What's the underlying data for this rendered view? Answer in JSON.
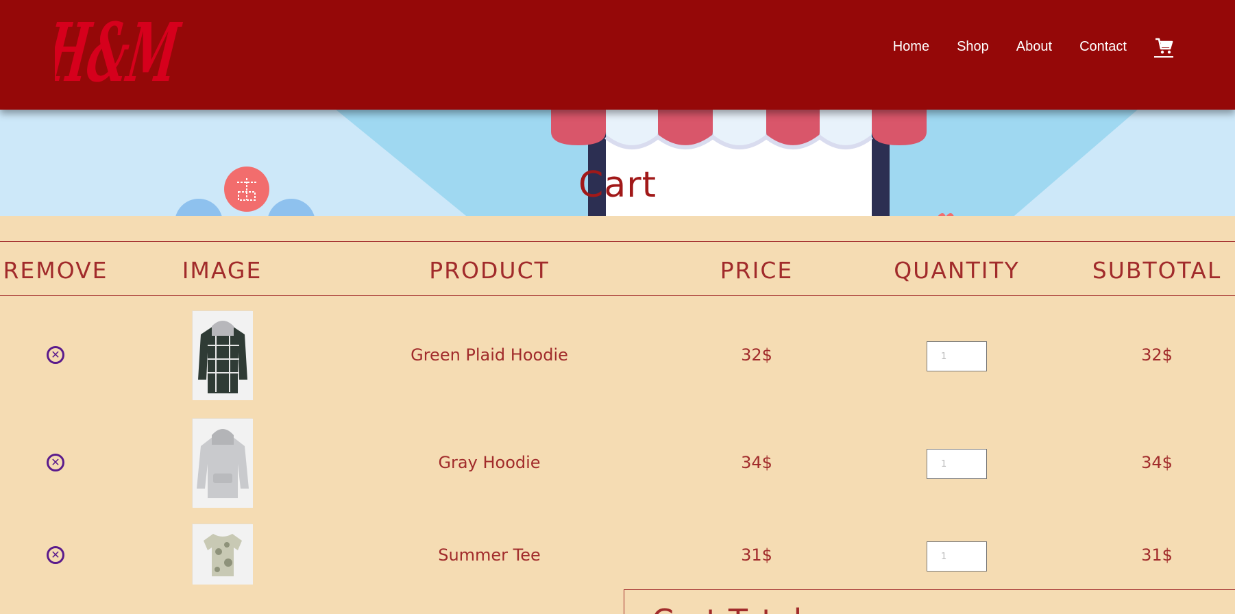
{
  "brand": {
    "logo_text": "H&M"
  },
  "nav": {
    "items": [
      "Home",
      "Shop",
      "About",
      "Contact"
    ],
    "cart_icon": "cart-icon"
  },
  "hero": {
    "title": "Cart"
  },
  "table": {
    "headers": [
      "REMOVE",
      "IMAGE",
      "PRODUCT",
      "PRICE",
      "QUANTITY",
      "SUBTOTAL"
    ],
    "rows": [
      {
        "product": "Green Plaid Hoodie",
        "price": "32$",
        "quantity": "1",
        "subtotal": "32$",
        "image": "green-plaid-hoodie-image"
      },
      {
        "product": "Gray Hoodie",
        "price": "34$",
        "quantity": "1",
        "subtotal": "34$",
        "image": "gray-hoodie-image"
      },
      {
        "product": "Summer Tee",
        "price": "31$",
        "quantity": "1",
        "subtotal": "31$",
        "image": "summer-tee-image"
      }
    ]
  },
  "totals": {
    "title": "Cart Totals"
  },
  "colors": {
    "header_bg": "#950808",
    "page_bg": "#f5dcb3",
    "accent_text": "#a12b2b",
    "remove_icon": "#5a1a8c",
    "logo_red": "#d6001c"
  }
}
